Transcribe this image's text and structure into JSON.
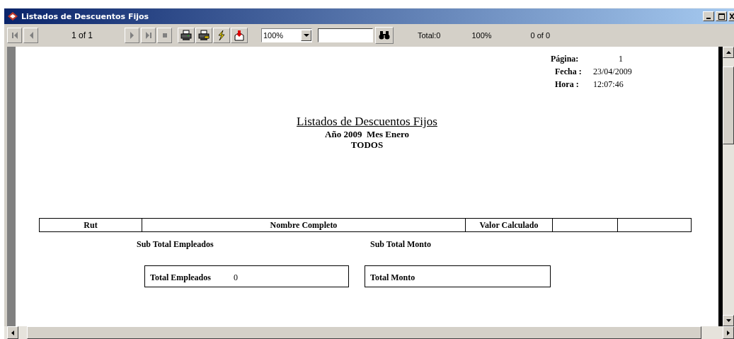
{
  "window": {
    "title": "Listados de Descuentos Fijos"
  },
  "toolbar": {
    "nav_left": [
      {
        "kind": "first",
        "disabled": true
      },
      {
        "kind": "prev",
        "disabled": true
      }
    ],
    "page_indicator": "1 of 1",
    "nav_right": [
      {
        "kind": "next",
        "disabled": true
      },
      {
        "kind": "last",
        "disabled": true
      },
      {
        "kind": "stop",
        "disabled": true
      }
    ],
    "actions": [
      {
        "kind": "print"
      },
      {
        "kind": "print-setup"
      },
      {
        "kind": "refresh"
      },
      {
        "kind": "export"
      }
    ],
    "zoom": {
      "value": "100%"
    },
    "total": "Total:0",
    "percent": "100%",
    "records": "0 of 0"
  },
  "report": {
    "header_fields": [
      {
        "label": "Página:",
        "value": "1"
      },
      {
        "label": "Fecha :",
        "value": "23/04/2009"
      },
      {
        "label": "Hora :",
        "value": "12:07:46"
      }
    ],
    "title": "Listados de Descuentos Fijos",
    "subtitle": "Año 2009  Mes Enero",
    "filter": "TODOS",
    "table": {
      "columns": [
        {
          "label": "Rut"
        },
        {
          "label": "Nombre Completo"
        },
        {
          "label": "Valor Calculado"
        },
        {
          "kind": "blank"
        },
        {
          "kind": "blank"
        }
      ]
    },
    "subtotals": [
      "Sub Total Empleados",
      "Sub Total Monto"
    ],
    "totals": [
      {
        "label": "Total Empleados",
        "value": "0"
      },
      {
        "label": "Total Monto"
      }
    ]
  }
}
